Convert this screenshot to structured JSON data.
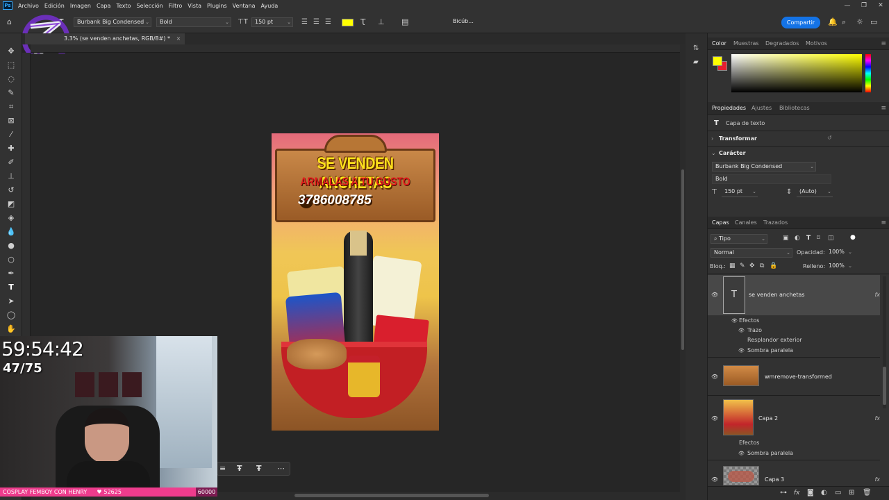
{
  "menu": {
    "app_icon": "Ps",
    "items": [
      "Archivo",
      "Edición",
      "Imagen",
      "Capa",
      "Texto",
      "Selección",
      "Filtro",
      "Vista",
      "Plugins",
      "Ventana",
      "Ayuda"
    ],
    "window_controls": [
      "—",
      "❐",
      "✕"
    ]
  },
  "options": {
    "font_family": "Burbank Big Condensed",
    "font_style": "Bold",
    "font_size": "150 pt",
    "antialias": "Bicúb...",
    "text_color": "#ffff00",
    "share_label": "Compartir"
  },
  "document": {
    "tab_label": "3.3% (se venden anchetas, RGB/8#) *",
    "tab_close": "×"
  },
  "artwork": {
    "line1": "SE VENDEN ANCHETAS",
    "line2": "ARMALAS A TU GUSTO",
    "phone": "3786008785"
  },
  "stream": {
    "timer": "59:54:42",
    "counter": "47/75",
    "ticker": "COSPLAY FEMBOY CON HENRY",
    "score": "52625",
    "goal": "60000"
  },
  "color_panel": {
    "tabs": [
      "Color",
      "Muestras",
      "Degradados",
      "Motivos"
    ],
    "foreground": "#ffff00",
    "background": "#e61e2e"
  },
  "properties_panel": {
    "tabs": [
      "Propiedades",
      "Ajustes",
      "Bibliotecas"
    ],
    "kind": "Capa de texto",
    "transform_label": "Transformar",
    "character_label": "Carácter",
    "font_family": "Burbank Big Condensed",
    "font_style": "Bold",
    "font_size": "150 pt",
    "leading": "(Auto)"
  },
  "layers_panel": {
    "tabs": [
      "Capas",
      "Canales",
      "Trazados"
    ],
    "filter": "Tipo",
    "blend_mode": "Normal",
    "opacity_label": "Opacidad:",
    "opacity": "100%",
    "lock_label": "Bloq.:",
    "fill_label": "Relleno:",
    "fill": "100%",
    "layers": [
      {
        "name": "se venden anchetas",
        "effects_label": "Efectos",
        "effects": [
          "Trazo",
          "Resplandor exterior",
          "Sombra paralela"
        ]
      },
      {
        "name": "wmremove-transformed"
      },
      {
        "name": "Capa 2",
        "effects_label": "Efectos",
        "effects": [
          "Sombra paralela"
        ]
      },
      {
        "name": "Capa 3"
      }
    ],
    "fx": "fx"
  }
}
